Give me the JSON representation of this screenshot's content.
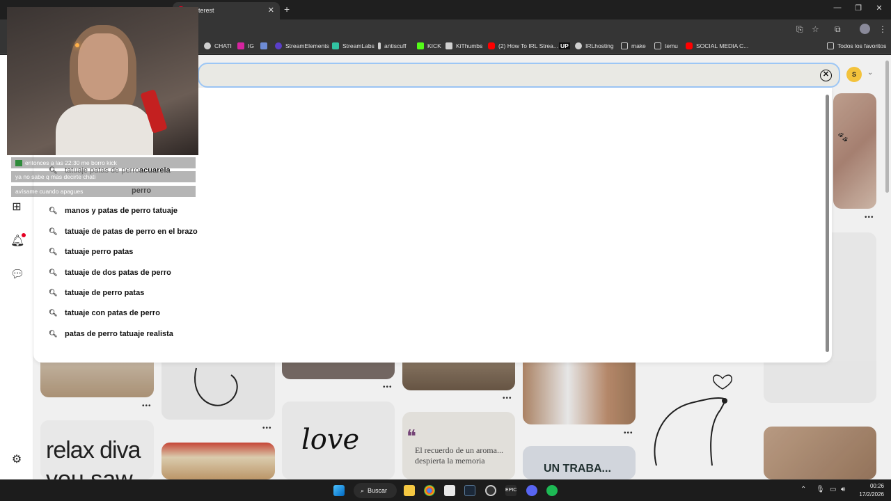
{
  "browser": {
    "tab_title": "Pinterest",
    "tab_close": "✕",
    "new_tab": "+",
    "window_controls": [
      "—",
      "❐",
      "✕"
    ],
    "bookmarks": [
      {
        "label": "CHATI",
        "color": "#cfcfcf"
      },
      {
        "label": "IG",
        "color": "#d6249f"
      },
      {
        "label": "",
        "color": "#6e8cd6"
      },
      {
        "label": "StreamElements",
        "color": "#5a3ec8"
      },
      {
        "label": "StreamLabs",
        "color": "#31c3a2"
      },
      {
        "label": "antiscuff",
        "color": "#cfcfcf"
      },
      {
        "label": "KICK",
        "color": "#53fc18"
      },
      {
        "label": "KiThumbs",
        "color": "#cfcfcf"
      },
      {
        "label": "(2) How To IRL Strea...",
        "color": "#ff0000"
      },
      {
        "label": "UP",
        "color": "#111111"
      },
      {
        "label": "IRLhosting",
        "color": "#cfcfcf"
      },
      {
        "label": "make",
        "color": "#cfcfcf"
      },
      {
        "label": "temu",
        "color": "#cfcfcf"
      },
      {
        "label": "SOCIAL MEDIA C...",
        "color": "#ff0000"
      }
    ],
    "all_bookmarks": "Todos los favoritos"
  },
  "search": {
    "value": "",
    "placeholder": "",
    "clear_icon": "✕",
    "profile_initial": "S"
  },
  "suggestions": [
    {
      "prefix": "tatuaje patas de perro ",
      "bold": "acuarela"
    },
    {
      "prefix": "",
      "bold": "perro"
    },
    {
      "prefix": "",
      "bold": "manos y patas de perro tatuaje"
    },
    {
      "prefix": "",
      "bold": "tatuaje de patas de perro en el brazo"
    },
    {
      "prefix": "",
      "bold": "tatuaje perro patas"
    },
    {
      "prefix": "",
      "bold": "tatuaje de dos patas de perro"
    },
    {
      "prefix": "",
      "bold": "tatuaje de perro patas"
    },
    {
      "prefix": "",
      "bold": "tatuaje con patas de perro"
    },
    {
      "prefix": "",
      "bold": "patas de perro tatuaje realista"
    }
  ],
  "chat": [
    {
      "user": "",
      "message": "entonces a las 22:30 me borro kick",
      "color": "#4a9cff"
    },
    {
      "user": "",
      "message": "ya no sabe q mas decirte chati",
      "color": "#4aff6a"
    },
    {
      "user": "",
      "message": "avísame cuando apagues",
      "color": "#4a9cff"
    }
  ],
  "pins": {
    "relax_text": "relax diva",
    "relax_text2": "you   saw",
    "love_text": "love",
    "quote_text": "El recuerdo de un aroma... despierta la memoria",
    "quote_mark": "❝",
    "bottom_text": "UN TRABA..."
  },
  "taskbar": {
    "search_label": "Buscar",
    "time": "00:26",
    "date": "17/2/2026"
  },
  "colors": {
    "pinterest_red": "#e60023",
    "profile_yellow": "#f3c23b"
  }
}
